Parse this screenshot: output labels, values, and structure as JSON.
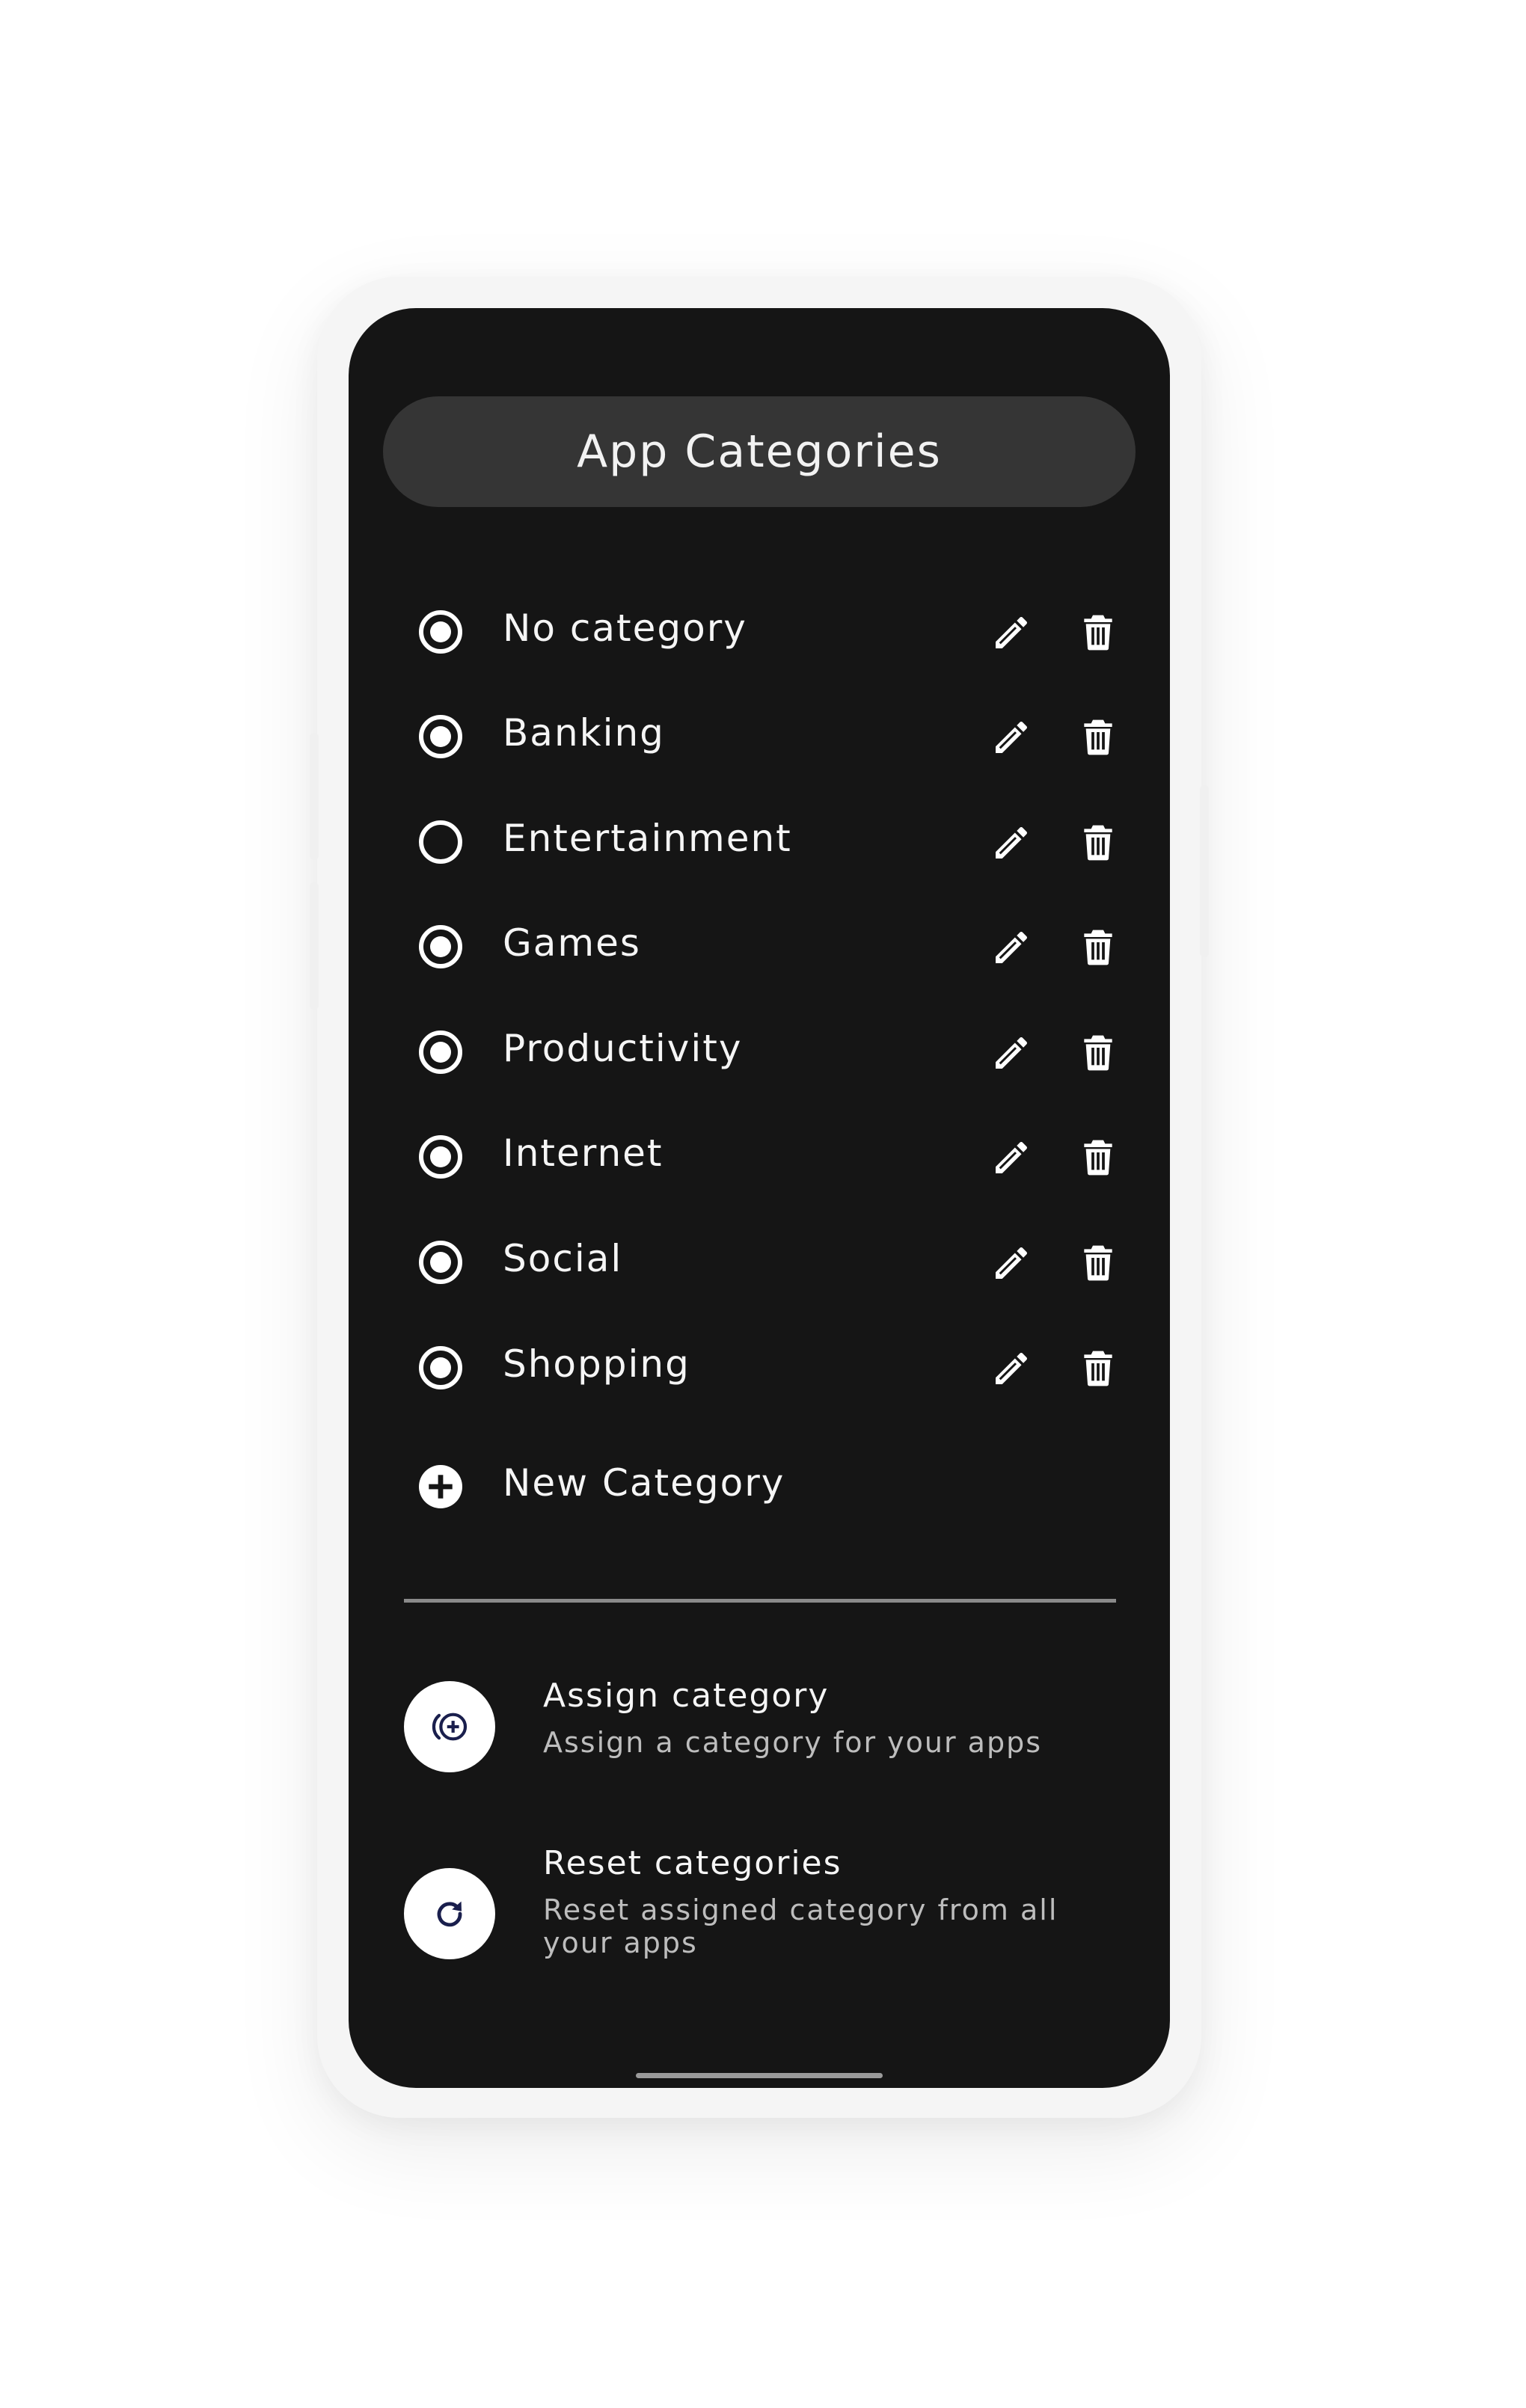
{
  "header": {
    "title": "App Categories"
  },
  "categories": [
    {
      "label": "No category",
      "selected": true
    },
    {
      "label": "Banking",
      "selected": true
    },
    {
      "label": "Entertainment",
      "selected": false
    },
    {
      "label": "Games",
      "selected": true
    },
    {
      "label": "Productivity",
      "selected": true
    },
    {
      "label": "Internet",
      "selected": true
    },
    {
      "label": "Social",
      "selected": true
    },
    {
      "label": "Shopping",
      "selected": true
    }
  ],
  "new_category": {
    "label": "New Category",
    "icon": "plus-circle-icon"
  },
  "actions": [
    {
      "title": "Assign category",
      "subtitle": "Assign a category for your apps",
      "icon": "assign-category-icon"
    },
    {
      "title": "Reset categories",
      "subtitle": "Reset assigned category from all your apps",
      "icon": "refresh-icon"
    }
  ],
  "icons": {
    "row_edit": "pencil-icon",
    "row_delete": "trash-icon",
    "radio_checked": "radio-checked-icon",
    "radio_unchecked": "radio-unchecked-icon"
  },
  "colors": {
    "screen_background": "#151515",
    "title_pill": "#353535",
    "text_primary": "#f5f5f5",
    "text_secondary": "#bdbdbd",
    "icon_accent": "#1a1f4d",
    "frame": "#f5f5f5"
  }
}
